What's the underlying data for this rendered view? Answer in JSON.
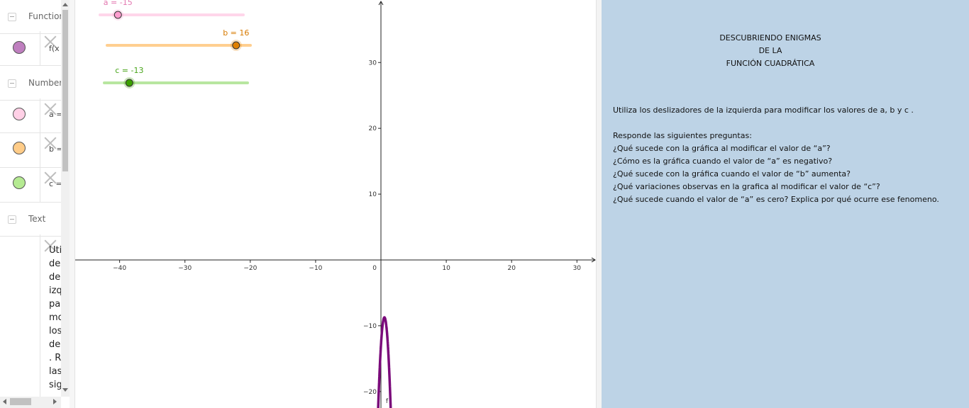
{
  "algebra": {
    "groups": [
      {
        "label": "Function"
      },
      {
        "label": "Number"
      },
      {
        "label": "Text"
      }
    ],
    "items": {
      "function_f": {
        "text": "f(x",
        "color": "#bf7fbf"
      },
      "slider_a": {
        "text": "a =",
        "color": "#ffd0e6"
      },
      "slider_b": {
        "text": "b =",
        "color": "#ffcc88"
      },
      "slider_c": {
        "text": "c =",
        "color": "#b5ea92"
      }
    },
    "text_item_lines": [
      "Uti",
      "des",
      "de",
      "izq",
      "par",
      "mo",
      "los",
      "de",
      ". R",
      "las",
      "sig"
    ]
  },
  "sliders": {
    "a": {
      "label": "a = -15",
      "value": -15,
      "min": -20,
      "max": 20,
      "color": "#ff9ecf",
      "track_color": "#ffd6ea",
      "label_color": "#e377b0"
    },
    "b": {
      "label": "b = 16",
      "value": 16,
      "min": -20,
      "max": 20,
      "color": "#e08000",
      "track_color": "#ffcf90",
      "label_color": "#d77a00"
    },
    "c": {
      "label": "c = -13",
      "value": -13,
      "min": -20,
      "max": 20,
      "color": "#3ba000",
      "track_color": "#b8e6a0",
      "label_color": "#49a51b"
    }
  },
  "graph": {
    "x_ticks": [
      -40,
      -30,
      -20,
      -10,
      10,
      20,
      30
    ],
    "y_ticks": [
      30,
      20,
      10,
      -10,
      -20
    ],
    "origin_label": "0",
    "xlim": [
      -46.8,
      32.9
    ],
    "ylim": [
      -22.5,
      39.5
    ],
    "function": {
      "label": "f",
      "a": -15,
      "b": 16,
      "c": -13,
      "color": "#7a0a7a"
    }
  },
  "panel": {
    "title_lines": [
      "DESCUBRIENDO ENIGMAS",
      "DE LA",
      "FUNCIÓN CUADRÁTICA"
    ],
    "instruction": "Utiliza los deslizadores de la izquierda para modificar los valores de a, b y c .",
    "questions_heading": "Responde las siguientes preguntas:",
    "questions": [
      "¿Qué sucede con la gráfica al modificar el valor de “a”?",
      "¿Cómo es la  gráfica cuando el valor de “a” es negativo?",
      "¿Qué sucede con la gráfica cuando el valor de “b” aumenta?",
      "¿Qué variaciones observas en la grafica al modificar el valor de “c”?",
      "¿Qué sucede cuando el valor de “a” es cero? Explica por qué ocurre ese fenomeno."
    ]
  }
}
